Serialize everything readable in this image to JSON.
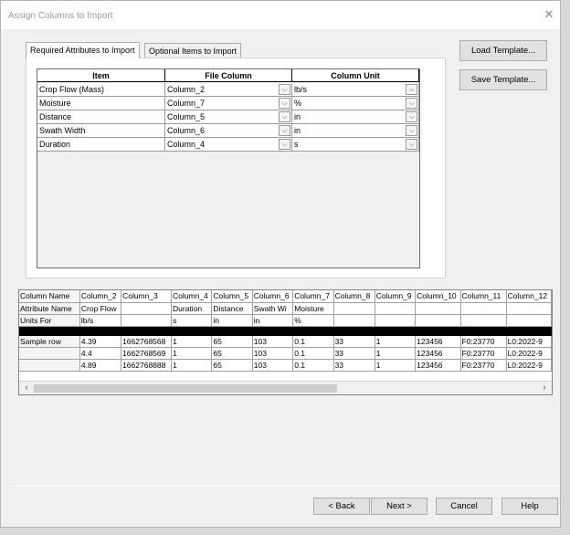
{
  "window": {
    "title": "Assign Columns to Import",
    "close_label": "✕"
  },
  "tabs": [
    {
      "label": "Required Attributes to Import",
      "active": true
    },
    {
      "label": "Optional Items to Import",
      "active": false
    }
  ],
  "template_buttons": {
    "load": "Load Template...",
    "save": "Save Template..."
  },
  "attributes": {
    "headers": [
      "Item",
      "File Column",
      "Column Unit"
    ],
    "rows": [
      {
        "item": "Crop Flow (Mass)",
        "column": "Column_2",
        "unit": "lb/s"
      },
      {
        "item": "Moisture",
        "column": "Column_7",
        "unit": "%"
      },
      {
        "item": "Distance",
        "column": "Column_5",
        "unit": "in"
      },
      {
        "item": "Swath Width",
        "column": "Column_6",
        "unit": "in"
      },
      {
        "item": "Duration",
        "column": "Column_4",
        "unit": "s"
      }
    ]
  },
  "data_grid": {
    "row_headers": [
      "Column Name",
      "Attribute Name",
      "Units For",
      "",
      "Sample row",
      "",
      ""
    ],
    "rows": [
      [
        "Column_2",
        "Column_3",
        "Column_4",
        "Column_5",
        "Column_6",
        "Column_7",
        "Column_8",
        "Column_9",
        "Column_10",
        "Column_11",
        "Column_12"
      ],
      [
        "Crop Flow",
        "",
        "Duration",
        "Distance",
        "Swath Wi",
        "Moisture",
        "",
        "",
        "",
        "",
        ""
      ],
      [
        "lb/s",
        "",
        "s",
        "in",
        "in",
        "%",
        "",
        "",
        "",
        "",
        ""
      ],
      [
        "",
        "",
        "",
        "",
        "",
        "",
        "",
        "",
        "",
        "",
        ""
      ],
      [
        "4.39",
        "1662768568",
        "1",
        "65",
        "103",
        "0.1",
        "33",
        "1",
        "123456",
        "F0:23770",
        "L0:2022-9"
      ],
      [
        "4.4",
        "1662768569",
        "1",
        "65",
        "103",
        "0.1",
        "33",
        "1",
        "123456",
        "F0:23770",
        "L0:2022-9"
      ],
      [
        "4.89",
        "1662768888",
        "1",
        "65",
        "103",
        "0.1",
        "33",
        "1",
        "123456",
        "F0:23770",
        "L0:2022-9"
      ]
    ]
  },
  "footer_buttons": {
    "back": "< Back",
    "next": "Next >",
    "cancel": "Cancel",
    "help": "Help"
  },
  "colors": {
    "window_bg": "#f0f0f0",
    "panel_bg": "#ffffff",
    "button_bg": "#e1e1e1"
  }
}
